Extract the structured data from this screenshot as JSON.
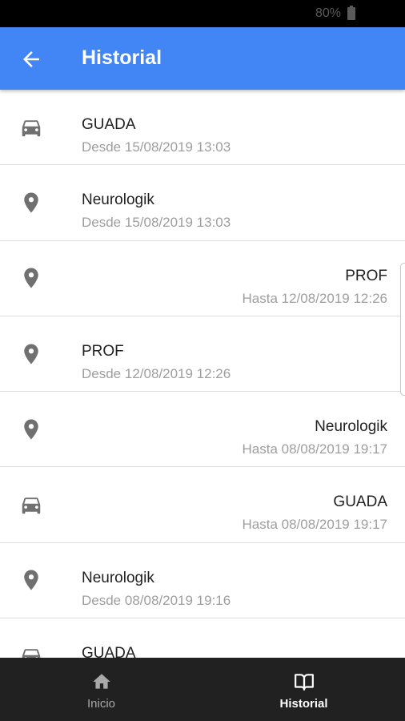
{
  "status_bar": {
    "battery": "80%"
  },
  "app_bar": {
    "title": "Historial"
  },
  "rows": [
    {
      "type": "car",
      "align": "left",
      "title": "GUADA",
      "subtitle": "Desde 15/08/2019 13:03"
    },
    {
      "type": "place",
      "align": "left",
      "title": "Neurologik",
      "subtitle": "Desde 15/08/2019 13:03"
    },
    {
      "type": "place",
      "align": "right",
      "title": "PROF",
      "subtitle": "Hasta 12/08/2019 12:26"
    },
    {
      "type": "place",
      "align": "left",
      "title": "PROF",
      "subtitle": "Desde 12/08/2019 12:26"
    },
    {
      "type": "place",
      "align": "right",
      "title": "Neurologik",
      "subtitle": "Hasta 08/08/2019 19:17"
    },
    {
      "type": "car",
      "align": "right",
      "title": "GUADA",
      "subtitle": "Hasta 08/08/2019 19:17"
    },
    {
      "type": "place",
      "align": "left",
      "title": "Neurologik",
      "subtitle": "Desde 08/08/2019 19:16"
    },
    {
      "type": "car",
      "align": "left",
      "title": "GUADA",
      "subtitle": ""
    }
  ],
  "bottom_nav": [
    {
      "label": "Inicio",
      "icon": "home-icon",
      "active": false
    },
    {
      "label": "Historial",
      "icon": "book-icon",
      "active": true
    }
  ],
  "colors": {
    "primary": "#4285f4",
    "nav_bg": "#212121",
    "icon_grey": "#707070"
  }
}
